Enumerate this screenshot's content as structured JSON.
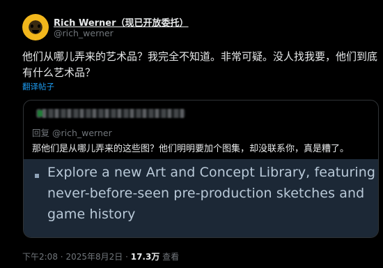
{
  "author": {
    "display_name": "Rich Werner（现已开放委托）",
    "handle": "@rich_werner"
  },
  "post": {
    "text": "他们从哪儿弄来的艺术品？我完全不知道。非常可疑。没人找我要，他们到底有什么艺术品？",
    "translate_label": "翻译帖子"
  },
  "quote": {
    "reply_to": "回复 @rich_werner",
    "text": "那他们是从哪儿弄来的这些图？他们明明要加个图集，却没联系你，真是糟了。",
    "image_lines": [
      "Explore a new Art and Concept Library, featuring",
      "never-before-seen pre-production sketches and",
      "game history"
    ]
  },
  "meta": {
    "time": "下午2:08",
    "sep": "·",
    "date": "2025年8月2日",
    "views": "17.3万",
    "views_label": "查看"
  }
}
